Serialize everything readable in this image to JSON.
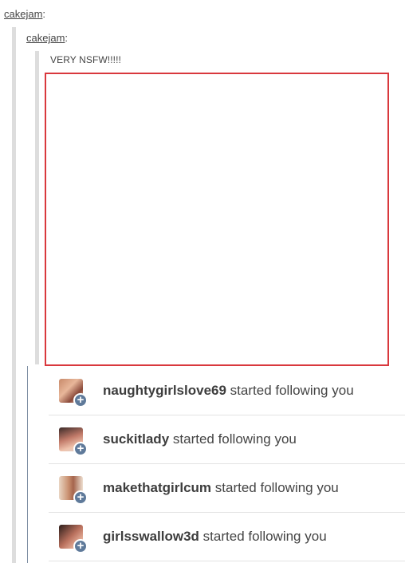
{
  "reblog_chain": [
    {
      "username": "cakejam",
      "separator": ":"
    },
    {
      "username": "cakejam",
      "separator": ":"
    }
  ],
  "post": {
    "text": "VERY NSFW!!!!!"
  },
  "notifications": [
    {
      "username": "naughtygirlslove69",
      "action": "started following you"
    },
    {
      "username": "suckitlady",
      "action": "started following you"
    },
    {
      "username": "makethatgirlcum",
      "action": "started following you"
    },
    {
      "username": "girlsswallow3d",
      "action": "started following you"
    }
  ],
  "colors": {
    "frame_border": "#d9383d",
    "quote_bar": "#dddddd",
    "badge": "#5f7a9a",
    "panel_border": "#7f8fa3"
  },
  "icons": [
    "avatar",
    "plus-icon"
  ]
}
